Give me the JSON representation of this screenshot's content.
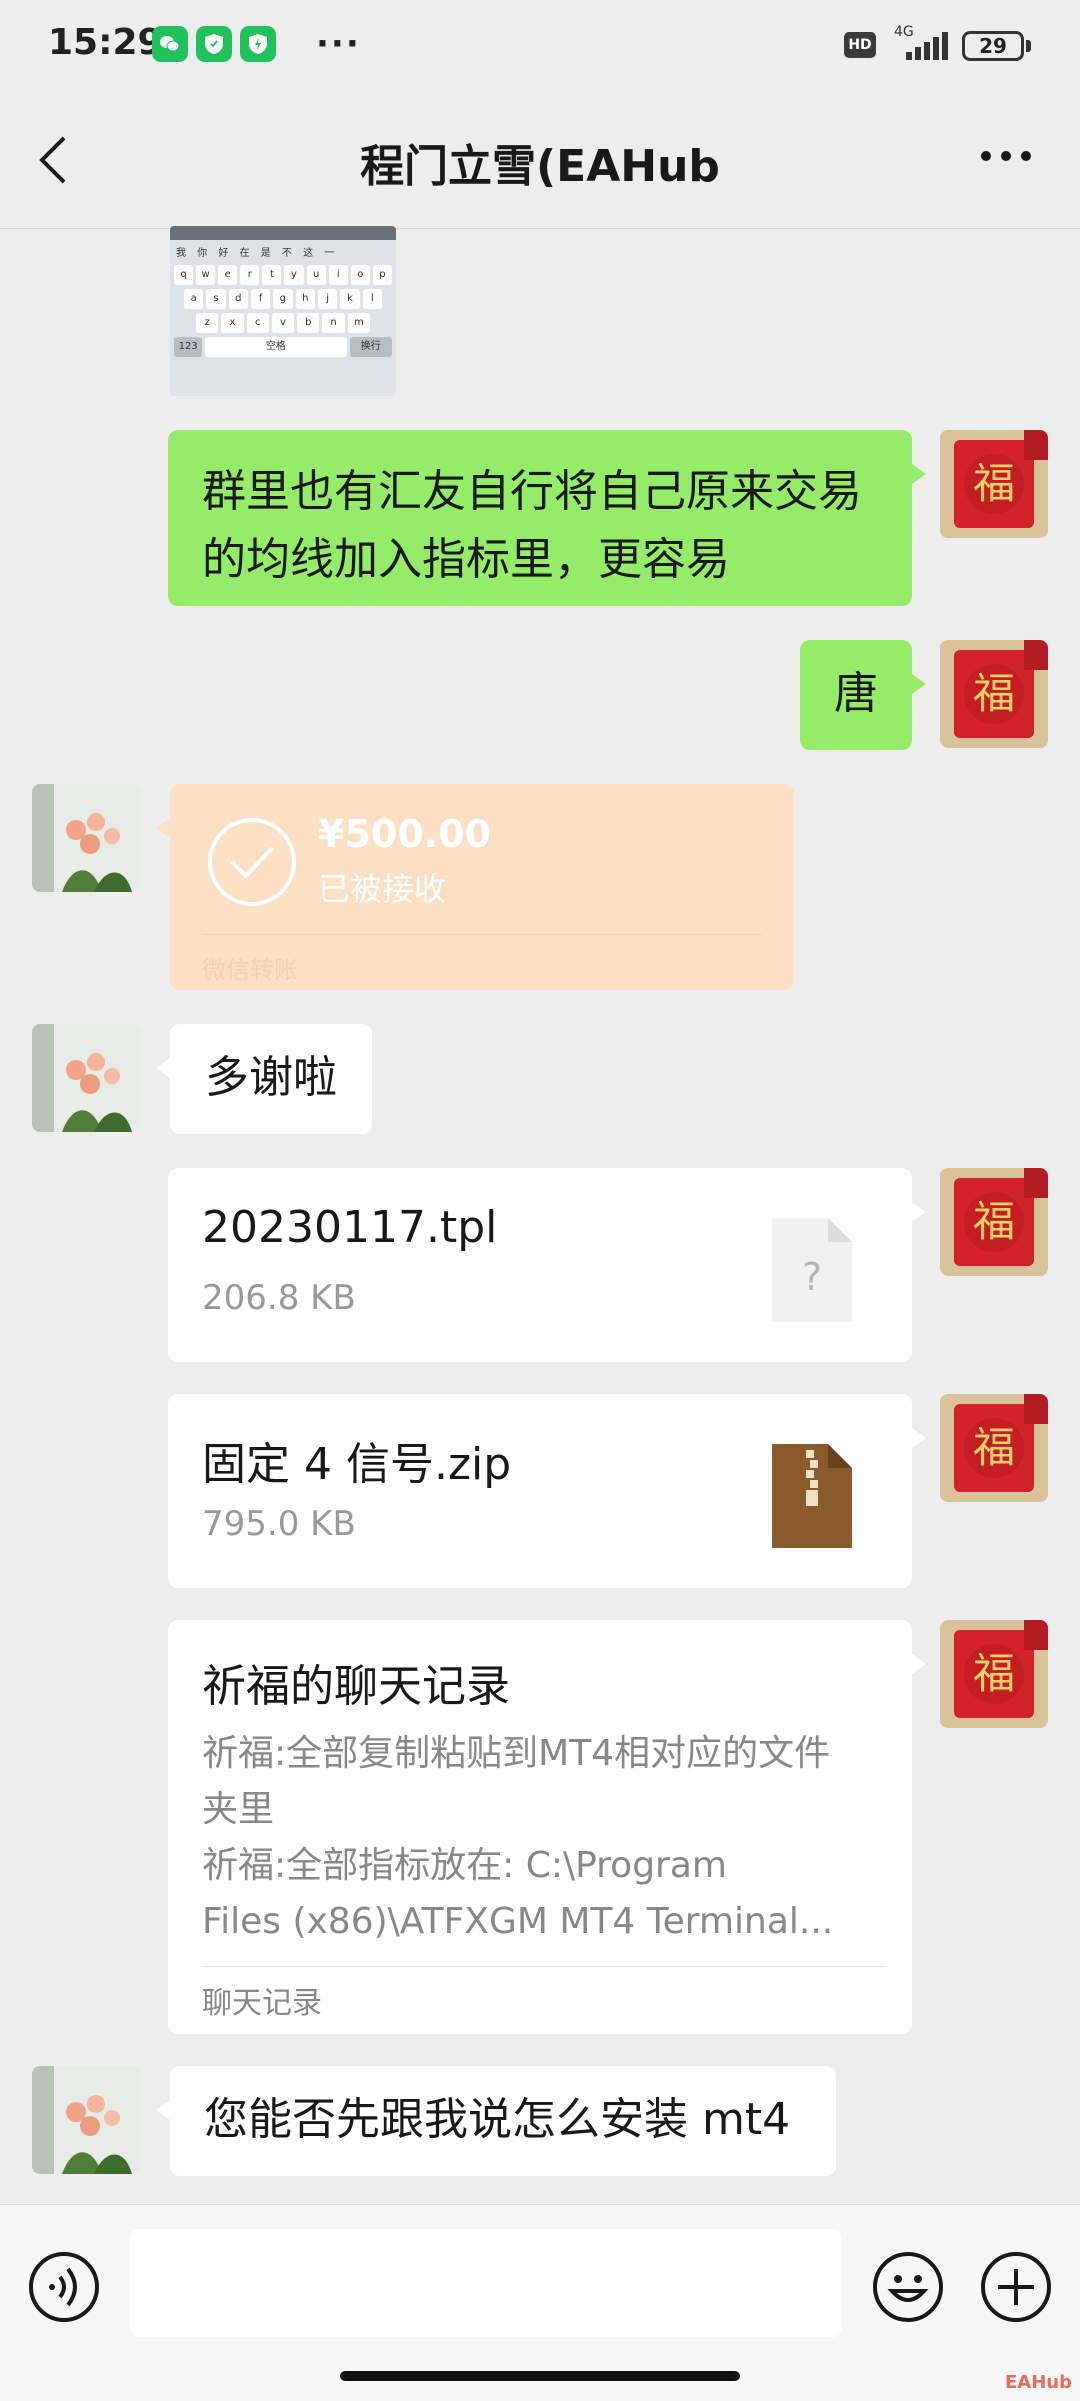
{
  "status": {
    "time": "15:29",
    "apps": [
      "wechat-icon",
      "shield-icon",
      "shield-icon"
    ],
    "more": "···",
    "hd": "HD",
    "network": "4G",
    "battery": "29"
  },
  "header": {
    "title": "程门立雪(EAHub"
  },
  "messages": {
    "m1": "群里也有汇友自行将自己原来交易的均线加入指标里，更容易",
    "m2": "唐",
    "transfer": {
      "amount": "¥500.00",
      "status": "已被接收",
      "label": "微信转账"
    },
    "m3": "多谢啦",
    "file1": {
      "name": "20230117.tpl",
      "size": "206.8 KB"
    },
    "file2": {
      "name": "固定 4 信号.zip",
      "size": "795.0 KB"
    },
    "record": {
      "title": "祈福的聊天记录",
      "line1": "祈福:全部复制粘贴到MT4相对应的文件",
      "line2": "夹里",
      "line3": "祈福:全部指标放在: C:\\Program",
      "line4": "Files (x86)\\ATFXGM MT4 Terminal...",
      "label": "聊天记录"
    },
    "m4": "您能否先跟我说怎么安装 mt4"
  },
  "keyboard_image": {
    "candidates": "我 你 好 在 是 不 这 一",
    "row1": [
      "q",
      "w",
      "e",
      "r",
      "t",
      "y",
      "u",
      "i",
      "o",
      "p"
    ],
    "row2": [
      "a",
      "s",
      "d",
      "f",
      "g",
      "h",
      "j",
      "k",
      "l"
    ],
    "row3": [
      "z",
      "x",
      "c",
      "v",
      "b",
      "n",
      "m"
    ],
    "row4_left": "123",
    "row4_space": "空格",
    "row4_right": "换行"
  },
  "watermark": "EAHub",
  "colors": {
    "background": "#ededed",
    "bubble_green": "#95ec69",
    "transfer_orange": "#fbe0c4",
    "zip_brown": "#8b5a2b"
  }
}
